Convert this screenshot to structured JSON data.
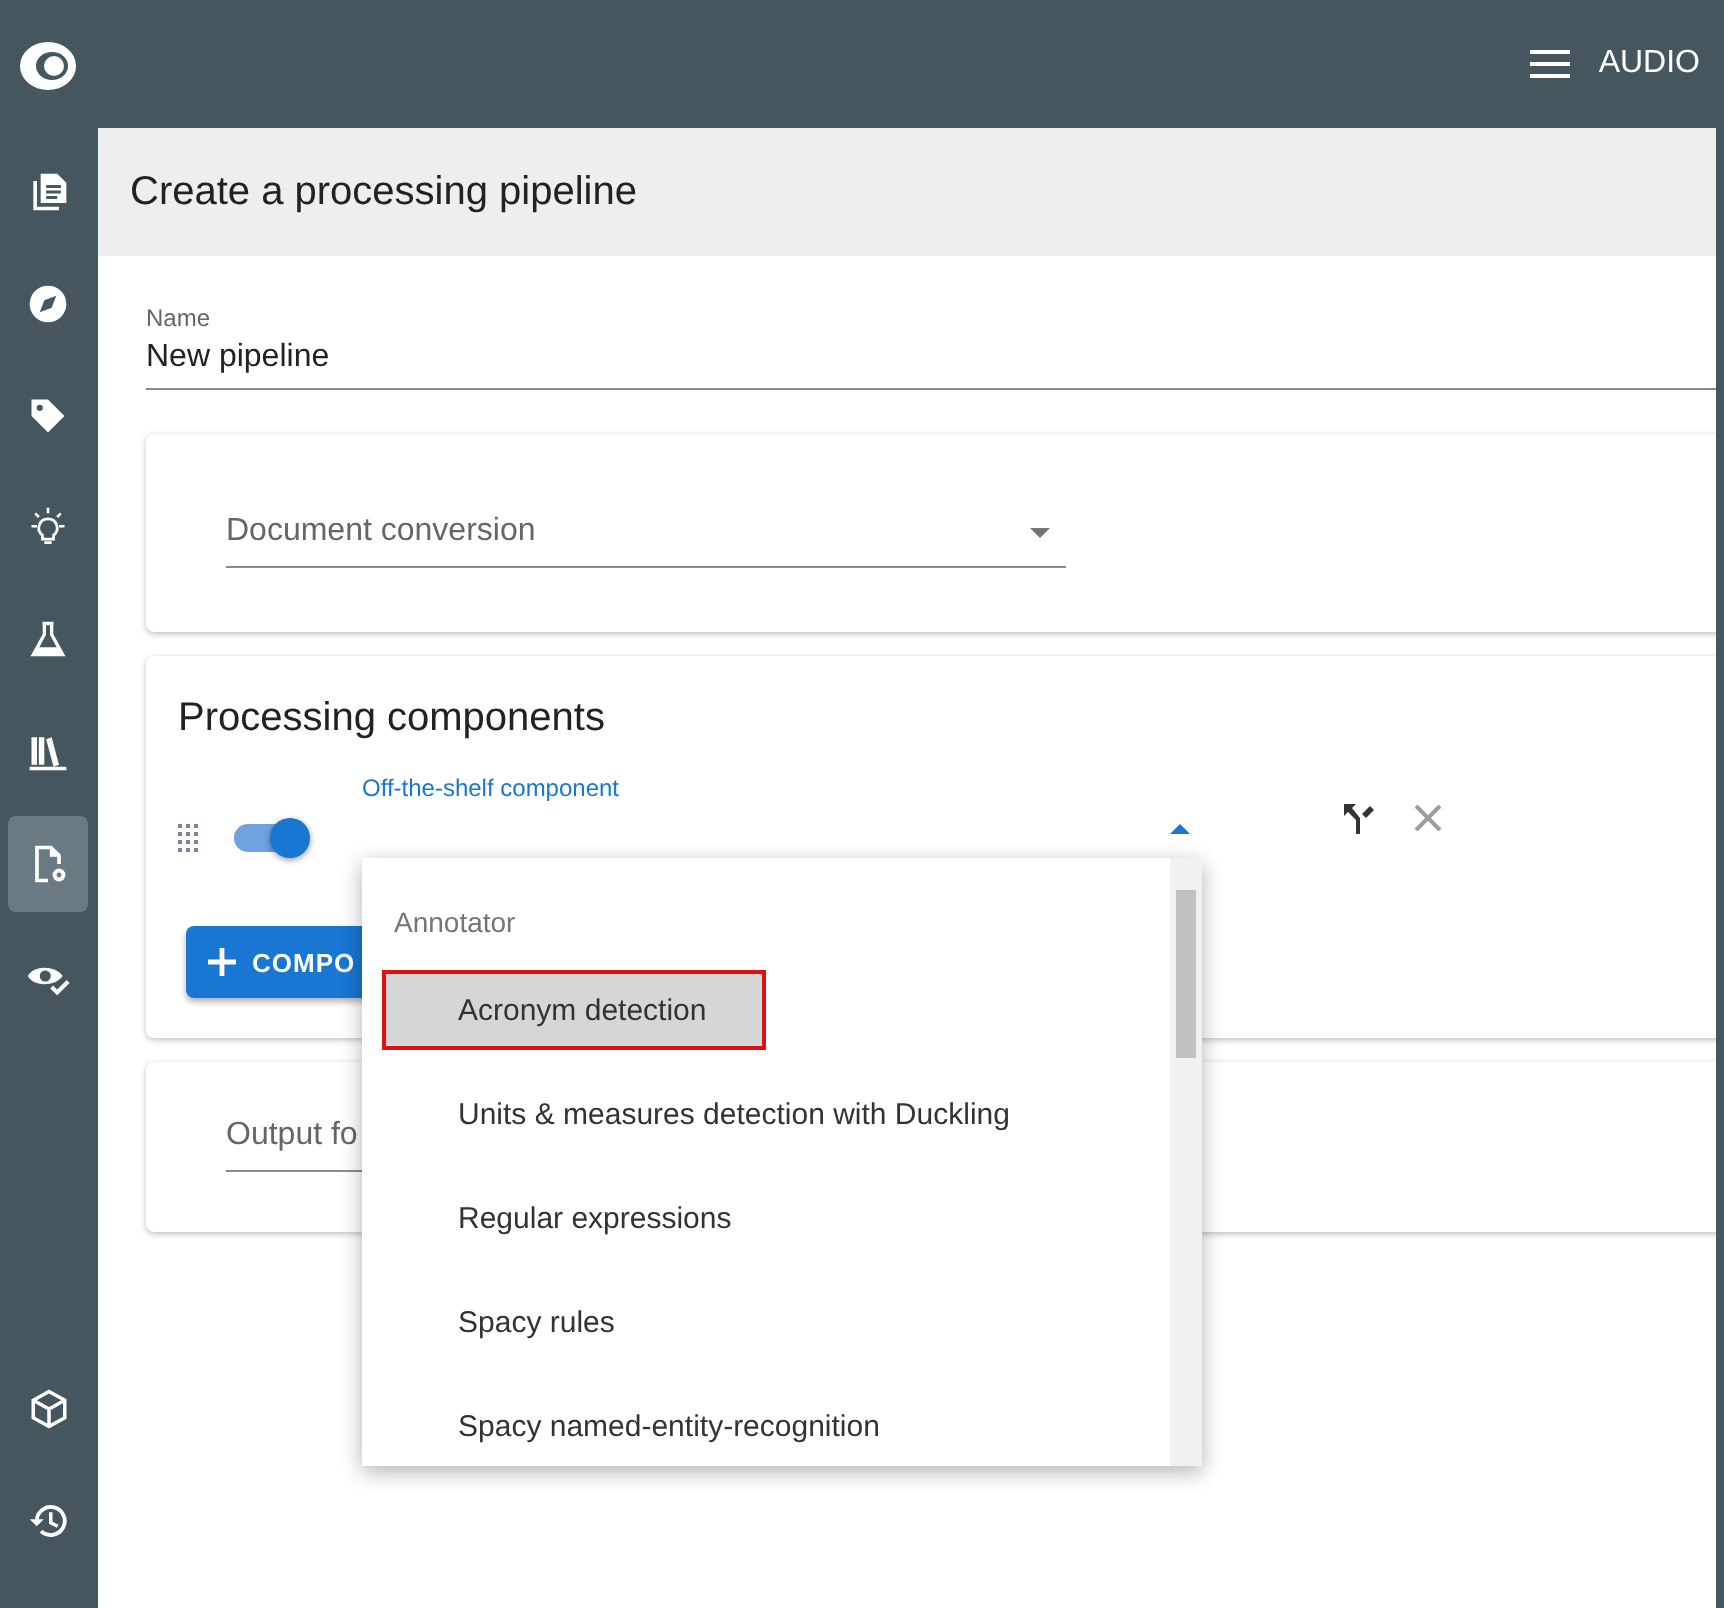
{
  "topbar": {
    "menu_label": "AUDIO"
  },
  "sidebar": {
    "items": [
      {
        "selected": false
      },
      {
        "selected": false
      },
      {
        "selected": false
      },
      {
        "selected": false
      },
      {
        "selected": false
      },
      {
        "selected": false
      },
      {
        "selected": true
      },
      {
        "selected": false
      }
    ],
    "bottom_items": [
      {
        "selected": false
      },
      {
        "selected": false
      }
    ]
  },
  "page_title": "Create a processing pipeline",
  "name_field": {
    "label": "Name",
    "value": "New pipeline"
  },
  "conversion": {
    "placeholder": "Document conversion"
  },
  "processing": {
    "title": "Processing components",
    "component": {
      "enabled": true,
      "label": "Off-the-shelf component",
      "expanded": true
    },
    "add_button": "COMPO"
  },
  "dropdown": {
    "group": "Annotator",
    "options": [
      {
        "label": "Acronym detection",
        "selected": true
      },
      {
        "label": "Units & measures detection with Duckling",
        "selected": false
      },
      {
        "label": "Regular expressions",
        "selected": false
      },
      {
        "label": "Spacy rules",
        "selected": false
      },
      {
        "label": "Spacy named-entity-recognition",
        "selected": false
      }
    ]
  },
  "output": {
    "placeholder": "Output fo"
  }
}
